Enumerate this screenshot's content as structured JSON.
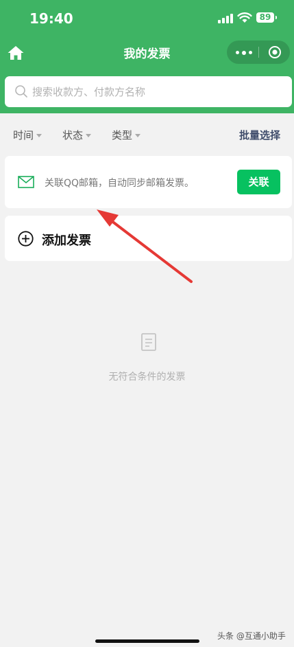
{
  "status_bar": {
    "time": "19:40",
    "battery": "89"
  },
  "nav": {
    "title": "我的发票"
  },
  "search": {
    "placeholder": "搜索收款方、付款方名称"
  },
  "filters": [
    {
      "label": "时间"
    },
    {
      "label": "状态"
    },
    {
      "label": "类型"
    }
  ],
  "batch_select": "批量选择",
  "email_card": {
    "text": "关联QQ邮箱，自动同步邮箱发票。",
    "button": "关联"
  },
  "add_card": {
    "label": "添加发票"
  },
  "empty_state": {
    "text": "无符合条件的发票"
  },
  "watermark": "头条 @互通小助手",
  "colors": {
    "header_green": "#3eb464",
    "button_green": "#07c160",
    "annotation_arrow": "#e53935"
  }
}
